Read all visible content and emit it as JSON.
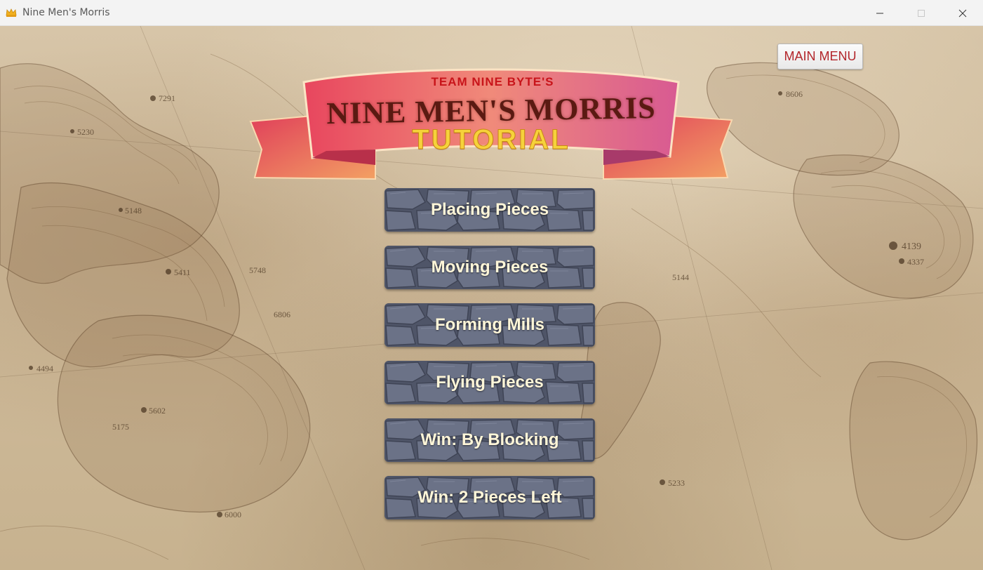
{
  "window": {
    "title": "Nine Men's Morris",
    "app_icon": "crown-icon",
    "controls": [
      "minimize-icon",
      "maximize-icon",
      "close-icon"
    ]
  },
  "header": {
    "main_menu_label": "MAIN MENU"
  },
  "banner": {
    "kicker": "TEAM NINE BYTE'S",
    "title": "NINE MEN'S MORRIS",
    "subtitle": "TUTORIAL"
  },
  "tutorial_menu": {
    "items": [
      {
        "label": "Placing Pieces"
      },
      {
        "label": "Moving Pieces"
      },
      {
        "label": "Forming Mills"
      },
      {
        "label": "Flying Pieces"
      },
      {
        "label": "Win: By Blocking"
      },
      {
        "label": "Win: 2 Pieces Left"
      }
    ]
  },
  "map_labels": [
    "7291",
    "5230",
    "5148",
    "5411",
    "6806",
    "5748",
    "6000",
    "5602",
    "4494",
    "4139",
    "4337",
    "8606",
    "5233",
    "5175",
    "5144"
  ],
  "colors": {
    "main_menu_text": "#b3262b",
    "button_stone": "#5d6478",
    "button_text": "#fff6d8",
    "banner_kicker": "#c8141a",
    "banner_subtitle": "#f6d23b"
  }
}
